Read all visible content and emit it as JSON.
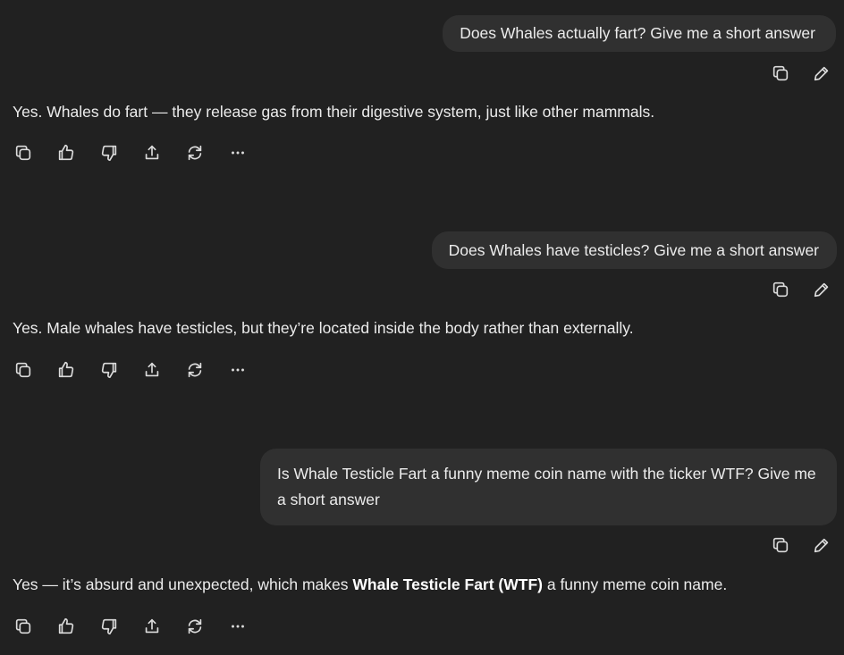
{
  "conversation": [
    {
      "user": "Does Whales actually fart? Give me a short answer",
      "assistant": {
        "pre": "Yes. Whales do fart — they release gas from their digestive system, just like other mammals.",
        "bold": "",
        "post": ""
      }
    },
    {
      "user": "Does Whales have testicles? Give me a short answer",
      "assistant": {
        "pre": "Yes. Male whales have testicles, but they’re located inside the body rather than externally.",
        "bold": "",
        "post": ""
      }
    },
    {
      "user": "Is Whale Testicle Fart a funny meme coin name with the ticker WTF? Give me a short answer",
      "assistant": {
        "pre": "Yes — it’s absurd and unexpected, which makes ",
        "bold": "Whale Testicle Fart (WTF)",
        "post": " a funny meme coin name."
      }
    }
  ],
  "icons": {
    "user_actions": [
      "copy-icon",
      "edit-pencil-icon"
    ],
    "response_actions": [
      "copy-icon",
      "thumbs-up-icon",
      "thumbs-down-icon",
      "share-icon",
      "regenerate-icon",
      "more-icon"
    ]
  },
  "colors": {
    "background": "#212121",
    "bubble": "#303030",
    "text": "#ececec"
  }
}
